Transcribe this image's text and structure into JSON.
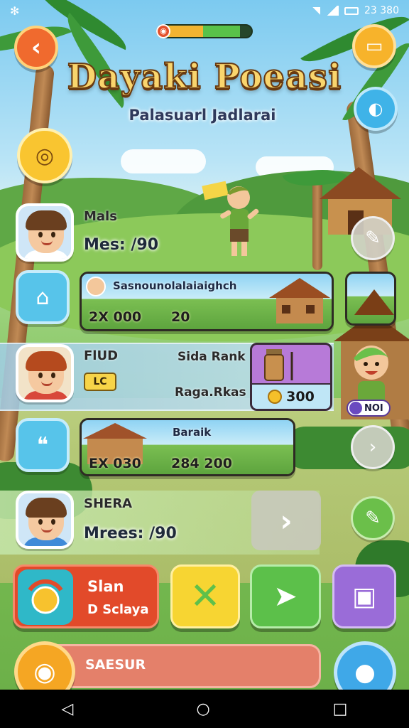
{
  "status_bar": {
    "time": "23 380"
  },
  "header": {
    "title": "Dayaki Poeasi",
    "subtitle": "Palasuarl Jadlarai",
    "progress": 0.88
  },
  "players": [
    {
      "name": "Mals",
      "score": "Mes: /90"
    },
    {
      "name": "FlUD"
    },
    {
      "name": "SHERA",
      "score": "Mrees: /90"
    }
  ],
  "cards": [
    {
      "label": "Sasnounolalaiaighch",
      "value_left": "2X 000",
      "value_right": "20"
    },
    {
      "label": "Baraik",
      "value_left": "EX 030",
      "value_right": "284 200"
    }
  ],
  "rank": {
    "title": "Sida Rank",
    "sub": "Raga.Rkas",
    "badge": "LC",
    "price": "300"
  },
  "npc": {
    "tag": "NOI"
  },
  "bottom_bar": {
    "slan_name": "Slan",
    "slan_sub": "D Sclaya",
    "search_label": "SAESUR"
  },
  "colors": {
    "accent_orange": "#f06a2e",
    "accent_blue": "#3fa8e8",
    "accent_green": "#5cc04a",
    "accent_purple": "#9a6cd8",
    "accent_red": "#e24a2a"
  },
  "icons": [
    "back-arrow-icon",
    "book-icon",
    "bird-icon",
    "camera-icon",
    "edit-icon",
    "next-arrow-icon",
    "x-icon",
    "send-icon",
    "box-icon",
    "home-icon",
    "chat-icon"
  ]
}
